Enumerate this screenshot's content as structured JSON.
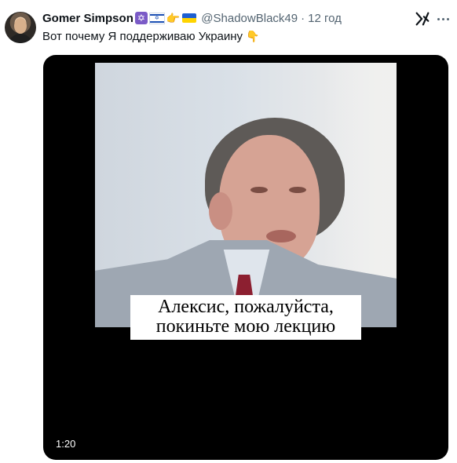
{
  "tweet": {
    "display_name": "Gomer Simpson",
    "handle": "@ShadowBlack49",
    "separator": "·",
    "time": "12 год",
    "text": "Вот почему Я поддерживаю Украину",
    "text_emoji": "👇"
  },
  "icons": {
    "avatar": "avatar",
    "name_icons": [
      "star-of-david-icon",
      "israel-flag-icon",
      "pointing-right-icon",
      "ukraine-flag-icon"
    ],
    "grok": "grok-icon",
    "more": "more-options-icon"
  },
  "media": {
    "caption_line1": "Алексис, пожалуйста,",
    "caption_line2": "покиньте мою лекцию",
    "duration": "1:20"
  },
  "colors": {
    "text": "#0f1419",
    "muted": "#536471",
    "media_background": "#000000"
  }
}
